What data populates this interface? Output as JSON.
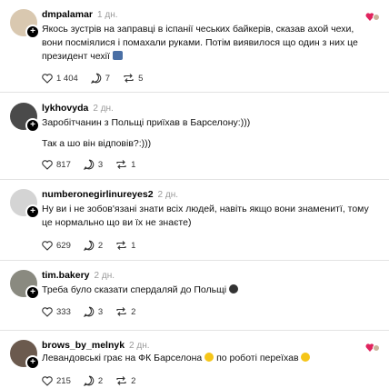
{
  "posts": [
    {
      "username": "dmpalamar",
      "time": "1 дн.",
      "text1": "Якось зустрів на заправці в іспанії чеських байкерів, сказав ахой чехи, вони посміялися і помахали руками. Потім виявилося що один з них це президент чехії",
      "text2": "",
      "likes": "1 404",
      "replies": "7",
      "reposts": "5"
    },
    {
      "username": "lykhovyda",
      "time": "2 дн.",
      "text1": "Заробітчанин з Польщі приїхав в Барселону:)))",
      "text2": "Так а шо він відповів?:)))",
      "likes": "817",
      "replies": "3",
      "reposts": "1"
    },
    {
      "username": "numberonegirlinureyes2",
      "time": "2 дн.",
      "text1": "Ну ви і не зобов'язані знати всіх людей, навіть якщо вони знаменитї, тому це нормально що ви їх не знаєте)",
      "text2": "",
      "likes": "629",
      "replies": "2",
      "reposts": "1"
    },
    {
      "username": "tim.bakery",
      "time": "2 дн.",
      "text1": "Треба було сказати спердаляй до Польщі",
      "text2": "",
      "likes": "333",
      "replies": "3",
      "reposts": "2"
    },
    {
      "username": "brows_by_melnyk",
      "time": "2 дн.",
      "text1": "Левандовські грає на ФК Барселона",
      "text1b": "по роботі переїхав",
      "text2": "",
      "likes": "215",
      "replies": "2",
      "reposts": "2"
    }
  ],
  "icons": {
    "like": "heart-outline-icon",
    "reply": "comment-bubble-icon",
    "repost": "repost-icon",
    "liked-by-author": "heart-avatar-badge-icon"
  }
}
